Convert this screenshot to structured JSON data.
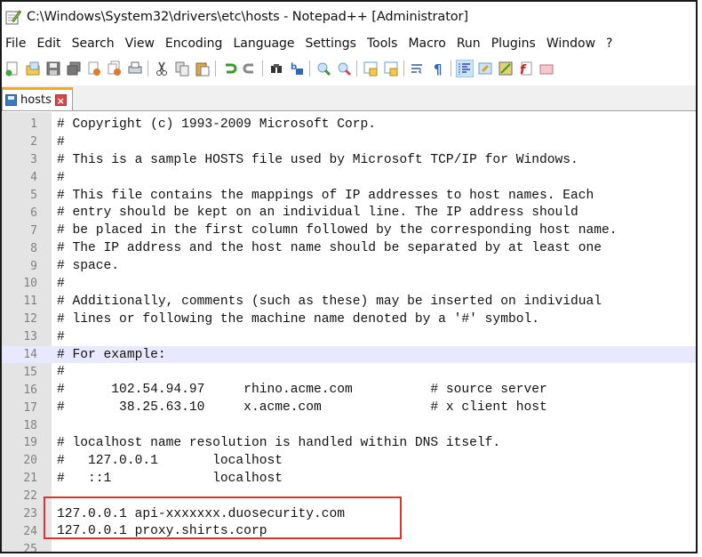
{
  "window": {
    "title": "C:\\Windows\\System32\\drivers\\etc\\hosts - Notepad++ [Administrator]",
    "app_icon": "notepad-pen-icon"
  },
  "menubar": {
    "items": [
      "File",
      "Edit",
      "Search",
      "View",
      "Encoding",
      "Language",
      "Settings",
      "Tools",
      "Macro",
      "Run",
      "Plugins",
      "Window",
      "?"
    ]
  },
  "toolbar": {
    "icons": [
      "new-file-icon",
      "open-file-icon",
      "save-icon",
      "save-all-icon",
      "close-icon",
      "close-all-icon",
      "print-icon",
      "cut-icon",
      "copy-icon",
      "paste-icon",
      "undo-icon",
      "redo-icon",
      "find-icon",
      "replace-icon",
      "zoom-in-icon",
      "zoom-out-icon",
      "sync-vertical-icon",
      "sync-horizontal-icon",
      "word-wrap-icon",
      "show-all-chars-icon",
      "indent-guide-icon",
      "user-language-icon",
      "document-map-icon",
      "function-list-icon",
      "folder-as-workspace-icon"
    ],
    "active_icon": "indent-guide-icon"
  },
  "tabs": [
    {
      "label": "hosts",
      "icon": "save-icon",
      "close": "close-tab-icon"
    }
  ],
  "editor": {
    "current_line": 14,
    "highlighted_lines": [
      23,
      24
    ],
    "highlight_color": "#d9342b",
    "lines": [
      "# Copyright (c) 1993-2009 Microsoft Corp.",
      "#",
      "# This is a sample HOSTS file used by Microsoft TCP/IP for Windows.",
      "#",
      "# This file contains the mappings of IP addresses to host names. Each",
      "# entry should be kept on an individual line. The IP address should",
      "# be placed in the first column followed by the corresponding host name.",
      "# The IP address and the host name should be separated by at least one",
      "# space.",
      "#",
      "# Additionally, comments (such as these) may be inserted on individual",
      "# lines or following the machine name denoted by a '#' symbol.",
      "#",
      "# For example:",
      "#",
      "#      102.54.94.97     rhino.acme.com          # source server",
      "#       38.25.63.10     x.acme.com              # x client host",
      "",
      "# localhost name resolution is handled within DNS itself.",
      "#   127.0.0.1       localhost",
      "#   ::1             localhost",
      "",
      "127.0.0.1 api-xxxxxxx.duosecurity.com",
      "127.0.0.1 proxy.shirts.corp",
      ""
    ]
  }
}
